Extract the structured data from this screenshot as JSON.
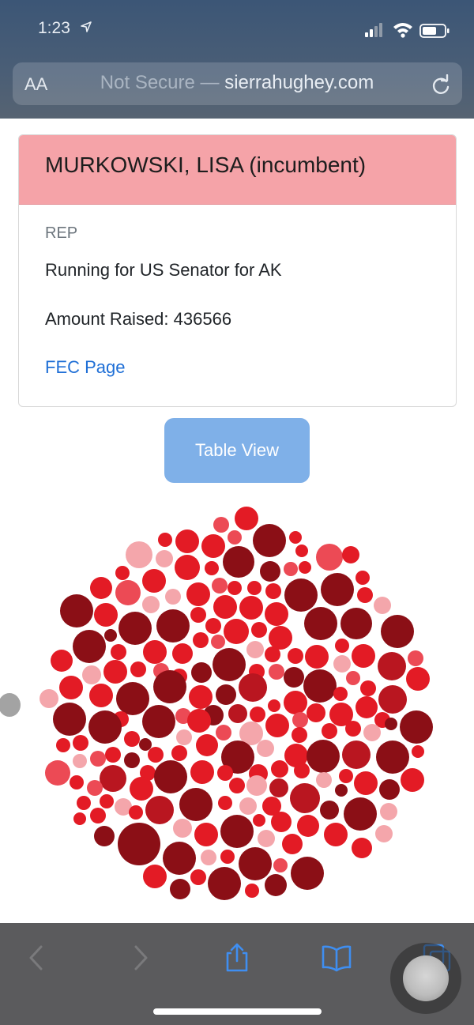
{
  "status_bar": {
    "time": "1:23"
  },
  "browser": {
    "aa_label": "AA",
    "security": "Not Secure —",
    "domain": "sierrahughey.com"
  },
  "candidate": {
    "name": "MURKOWSKI, LISA (incumbent)",
    "party": "REP",
    "running_for": "Running for US Senator for AK",
    "amount_raised": "Amount Raised: 436566",
    "fec_link": "FEC Page"
  },
  "table_view_label": "Table View",
  "colors": {
    "header_bg": "#f5a3a8",
    "link": "#1f6fd6",
    "button_bg": "#7fb0e8",
    "bubble_dark": "#8b0f16",
    "bubble_mid": "#b91620",
    "bubble_red": "#e31b25",
    "bubble_soft": "#ec4a55",
    "bubble_light": "#f4a6ab"
  }
}
